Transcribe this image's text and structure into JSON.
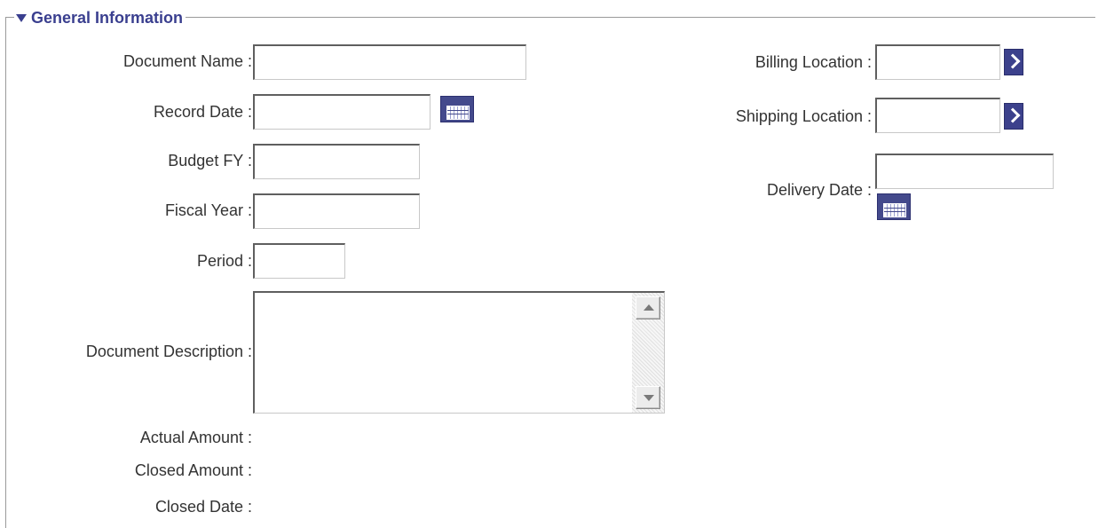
{
  "section": {
    "title": "General Information"
  },
  "left_fields": {
    "document_name": {
      "label": "Document Name :",
      "value": ""
    },
    "record_date": {
      "label": "Record Date :",
      "value": ""
    },
    "budget_fy": {
      "label": "Budget FY :",
      "value": ""
    },
    "fiscal_year": {
      "label": "Fiscal Year :",
      "value": ""
    },
    "period": {
      "label": "Period :",
      "value": ""
    },
    "document_description": {
      "label": "Document Description :",
      "value": ""
    }
  },
  "right_fields": {
    "billing_location": {
      "label": "Billing Location :",
      "value": ""
    },
    "shipping_location": {
      "label": "Shipping Location :",
      "value": ""
    },
    "delivery_date": {
      "label": "Delivery Date :",
      "value": ""
    }
  },
  "readonly_fields": {
    "actual_amount": {
      "label": "Actual Amount :",
      "value": ""
    },
    "closed_amount": {
      "label": "Closed Amount :",
      "value": ""
    },
    "closed_date": {
      "label": "Closed Date :",
      "value": ""
    }
  },
  "icons": {
    "section_toggle": "triangle-down-icon",
    "calendar": "calendar-icon",
    "lookup": "chevron-right-icon"
  },
  "colors": {
    "accent": "#3a3f8f",
    "button": "#444a8c",
    "value_text": "#d23a3a"
  }
}
